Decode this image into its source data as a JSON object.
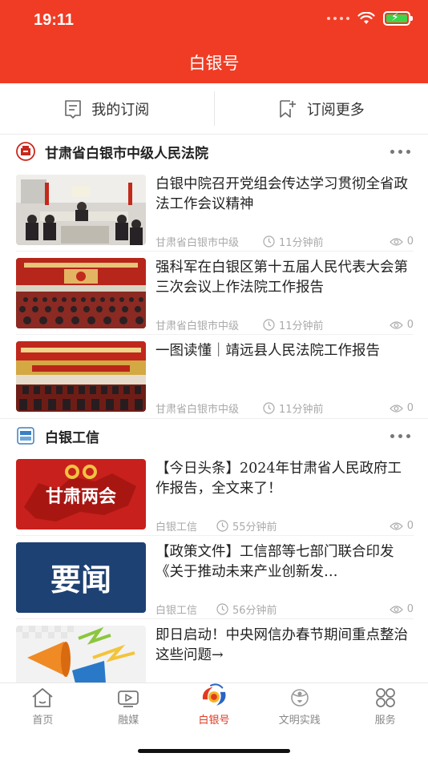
{
  "status": {
    "time": "19:11"
  },
  "nav": {
    "title": "白银号"
  },
  "subscribe": {
    "mine_label": "我的订阅",
    "more_label": "订阅更多"
  },
  "sections": [
    {
      "title": "甘肃省白银市中级人民法院",
      "logo_icon": "court-emblem-icon",
      "articles": [
        {
          "title": "白银中院召开党组会传达学习贯彻全省政法工作会议精神",
          "source": "甘肃省白银市中级",
          "time": "11分钟前",
          "views": "0"
        },
        {
          "title": "强科军在白银区第十五届人民代表大会第三次会议上作法院工作报告",
          "source": "甘肃省白银市中级",
          "time": "11分钟前",
          "views": "0"
        },
        {
          "title": "一图读懂｜靖远县人民法院工作报告",
          "source": "甘肃省白银市中级",
          "time": "11分钟前",
          "views": "0"
        }
      ]
    },
    {
      "title": "白银工信",
      "logo_icon": "baiyin-gongxin-logo-icon",
      "articles": [
        {
          "title": "【今日头条】2024年甘肃省人民政府工作报告，全文来了！",
          "source": "白银工信",
          "time": "55分钟前",
          "views": "0",
          "thumb_text": "甘肃两会"
        },
        {
          "title": "【政策文件】工信部等七部门联合印发《关于推动未来产业创新发…",
          "source": "白银工信",
          "time": "56分钟前",
          "views": "0",
          "thumb_text": "要闻"
        },
        {
          "title": "即日启动！中央网信办春节期间重点整治这些问题→",
          "source": "",
          "time": "",
          "views": ""
        }
      ]
    }
  ],
  "tabs": [
    {
      "label": "首页",
      "icon": "home-icon"
    },
    {
      "label": "融媒",
      "icon": "video-icon"
    },
    {
      "label": "白银号",
      "icon": "baiyin-logo-icon",
      "active": true
    },
    {
      "label": "文明实践",
      "icon": "civilization-icon"
    },
    {
      "label": "服务",
      "icon": "grid-services-icon"
    }
  ],
  "colors": {
    "brand": "#f03c24",
    "active_tab": "#e23a22",
    "meta": "#aaaaaa"
  }
}
